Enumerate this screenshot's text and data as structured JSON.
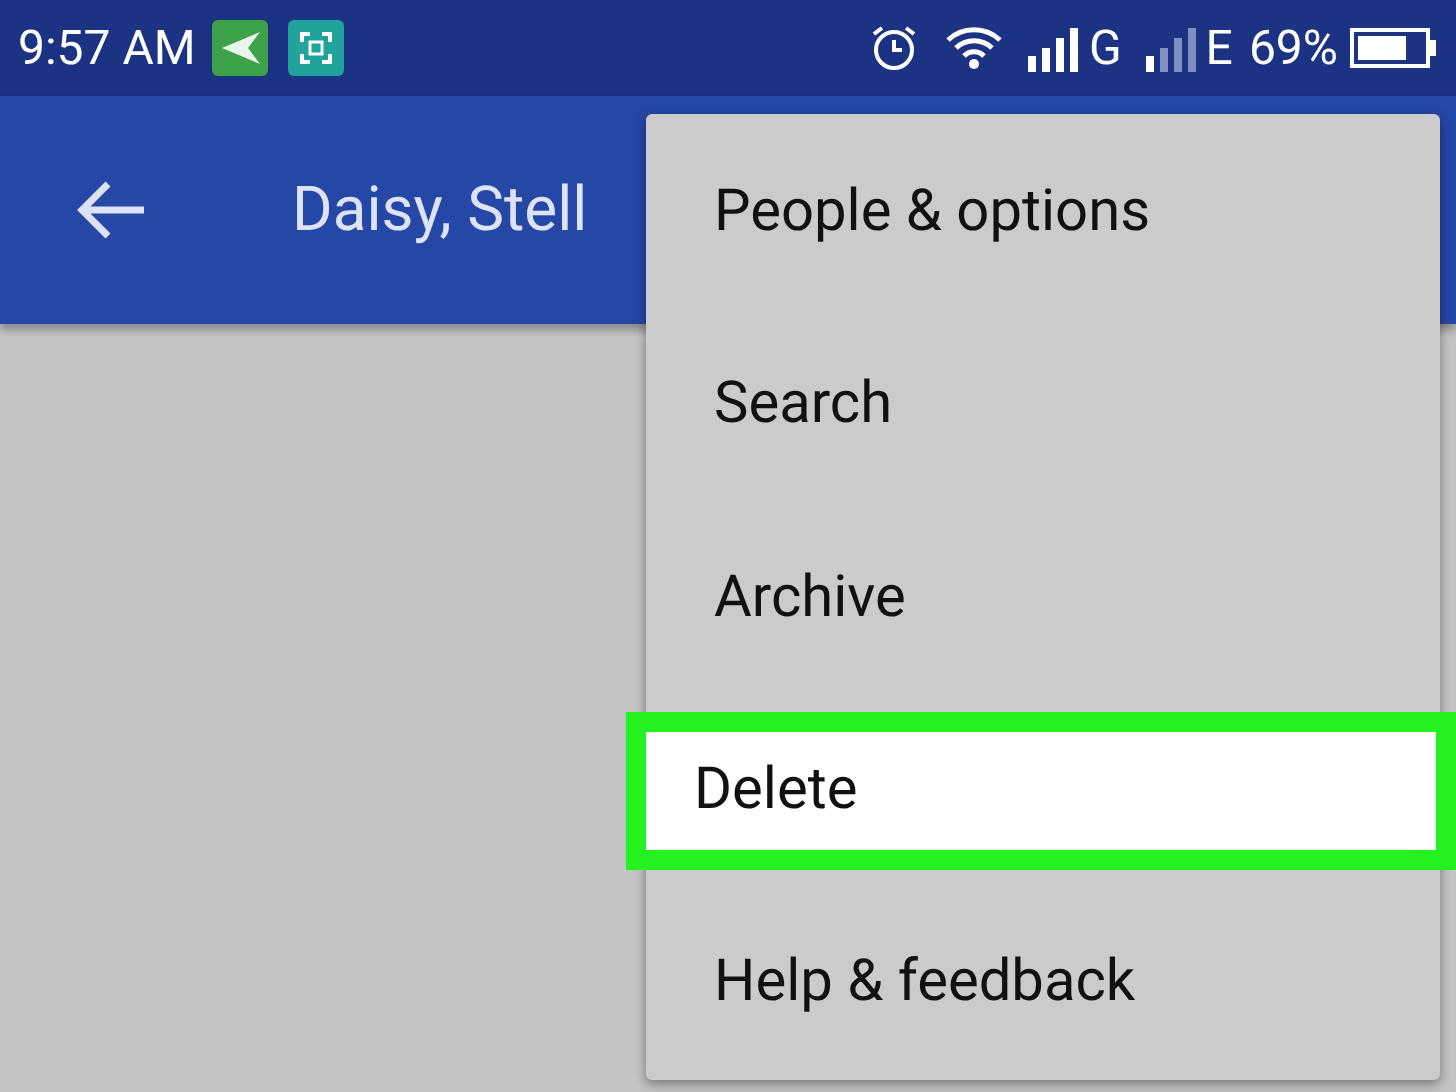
{
  "status_bar": {
    "time": "9:57 AM",
    "network_g": "G",
    "network_e": "E",
    "battery": "69%"
  },
  "app_bar": {
    "title": "Daisy, Stell"
  },
  "menu": {
    "items": [
      {
        "label": "People & options",
        "selected": false
      },
      {
        "label": "Search",
        "selected": false
      },
      {
        "label": "Archive",
        "selected": false
      },
      {
        "label": "Delete",
        "selected": true
      },
      {
        "label": "Help & feedback",
        "selected": false
      }
    ]
  }
}
